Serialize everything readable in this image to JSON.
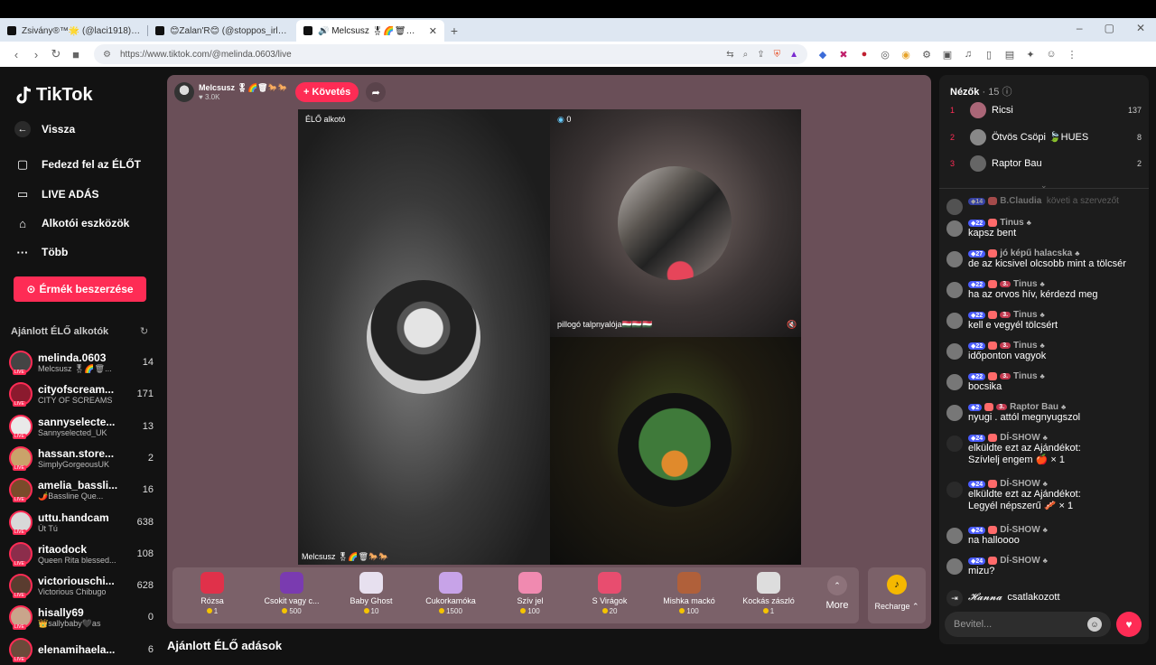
{
  "browser": {
    "tabs": [
      {
        "title": "Zsivány®™🌟 (@laci1918) ÉLŐ adás"
      },
      {
        "title": "😊Zalan'R😊 (@stoppos_irl) ÉLŐ ad"
      },
      {
        "title": "🔊 Melcsusz 🎖🌈🗑📦🎁🐎 (@"
      }
    ],
    "url": "https://www.tiktok.com/@melinda.0603/live",
    "window_controls": [
      "–",
      "▢",
      "✕"
    ]
  },
  "leftnav": {
    "logo": "TikTok",
    "back": "Vissza",
    "items": [
      {
        "label": "Fedezd fel az ÉLŐT",
        "icon": "explore-icon"
      },
      {
        "label": "LIVE ADÁS",
        "icon": "live-camera-icon"
      },
      {
        "label": "Alkotói eszközök",
        "icon": "creator-tools-icon"
      },
      {
        "label": "Több",
        "icon": "more-dots-icon"
      }
    ],
    "coins_button": "Érmék beszerzése",
    "recommended_title": "Ajánlott ÉLŐ alkotók",
    "creators": [
      {
        "name": "melinda.0603",
        "sub": "Melcsusz 🎖🌈🗑...",
        "count": "14",
        "color": "#444"
      },
      {
        "name": "cityofscream...",
        "sub": "CITY OF SCREAMS",
        "count": "171",
        "color": "#8b1a2e"
      },
      {
        "name": "sannyselecte...",
        "sub": "Sannyselected_UK",
        "count": "13",
        "color": "#e9e9e9"
      },
      {
        "name": "hassan.store...",
        "sub": "SimplyGorgeousUK",
        "count": "2",
        "color": "#caa36a"
      },
      {
        "name": "amelia_bassli...",
        "sub": "🌶️Bassline Que...",
        "count": "16",
        "color": "#7a4b2a"
      },
      {
        "name": "uttu.handcam",
        "sub": "Út Tú",
        "count": "638",
        "color": "#d8d8d8"
      },
      {
        "name": "ritaodock",
        "sub": "Queen Rita blessed...",
        "count": "108",
        "color": "#8c2d4b"
      },
      {
        "name": "victoriouschi...",
        "sub": "Victorious Chibugo",
        "count": "628",
        "color": "#5a3c2f"
      },
      {
        "name": "hisally69",
        "sub": "👑sallybaby🖤as",
        "count": "0",
        "color": "#c9a58b"
      },
      {
        "name": "elenamihaela...",
        "sub": "",
        "count": "6",
        "color": "#6b4a3a"
      }
    ]
  },
  "stage": {
    "host_name": "Melcsusz 🎖🌈🗑🐎🐎",
    "host_likes": "3.0K",
    "follow_label": "+ Követés",
    "main_label": "ÉLŐ alkotó",
    "main_bottom_label": "Melcsusz 🎖🌈🗑🐎🐎",
    "guest1_count": "0",
    "guest1_label": "pillogó talpnyalója🇭🇺🇭🇺🇭🇺",
    "gifts": [
      {
        "name": "Rózsa",
        "price": "1",
        "color": "#e0314a"
      },
      {
        "name": "Csokit vagy c...",
        "price": "500",
        "color": "#7a3bb0"
      },
      {
        "name": "Baby Ghost",
        "price": "10",
        "color": "#e7e0ef"
      },
      {
        "name": "Cukorkamóka",
        "price": "1500",
        "color": "#c7a3e8"
      },
      {
        "name": "Szív jel",
        "price": "100",
        "color": "#f08ab0"
      },
      {
        "name": "S Virágok",
        "price": "20",
        "color": "#e84d6f"
      },
      {
        "name": "Mishka mackó",
        "price": "100",
        "color": "#b0603a"
      },
      {
        "name": "Kockás zászló",
        "price": "1",
        "color": "#dddddd"
      }
    ],
    "more_label": "More",
    "recharge_label": "Recharge ⌃"
  },
  "below_title": "Ajánlott ÉLŐ adások",
  "chat": {
    "viewers_title": "Nézők",
    "viewers_count": "· 15",
    "top_viewers": [
      {
        "rank": "1",
        "name": "Ricsi",
        "score": "137",
        "color": "#a67"
      },
      {
        "rank": "2",
        "name": "Ötvös Csöpi 🍃HUES",
        "score": "8",
        "color": "#888"
      },
      {
        "rank": "3",
        "name": "Raptor Bau",
        "score": "2",
        "color": "#666"
      }
    ],
    "messages": [
      {
        "user": "B.Claudia",
        "level": "14",
        "text": "követi a szervezőt",
        "fan": "",
        "inline": true
      },
      {
        "user": "Tinus",
        "level": "22",
        "text": "kapsz bent",
        "fan": ""
      },
      {
        "user": "jó képű halacska",
        "level": "27",
        "text": "de az kicsivel olcsobb mint a tölcsér",
        "fan": ""
      },
      {
        "user": "Tinus",
        "level": "22",
        "text": "ha az orvos hív, kérdezd meg",
        "fan": "3."
      },
      {
        "user": "Tinus",
        "level": "22",
        "text": "kell e vegyél tölcsért",
        "fan": "3."
      },
      {
        "user": "Tinus",
        "level": "22",
        "text": "időponton vagyok",
        "fan": "3."
      },
      {
        "user": "Tinus",
        "level": "22",
        "text": "bocsika",
        "fan": "3."
      },
      {
        "user": "Raptor Bau",
        "level": "2",
        "text": "nyugi . attól megnyugszol",
        "fan": "3."
      },
      {
        "user": "DÍ-SHOW",
        "level": "24",
        "text": "elküldte ezt az Ajándékot:",
        "text2": "Szívlelj engem 🍎 × 1",
        "fan": ""
      },
      {
        "user": "DÍ-SHOW",
        "level": "24",
        "text": "elküldte ezt az Ajándékot:",
        "text2": "Legyél népszerű 🥓 × 1",
        "fan": ""
      },
      {
        "user": "DÍ-SHOW",
        "level": "24",
        "text": "na halloooo",
        "fan": ""
      },
      {
        "user": "DÍ-SHOW",
        "level": "24",
        "text": "mizu?",
        "fan": ""
      }
    ],
    "join_user": "𝓗𝓪𝓷𝓷𝓪",
    "join_text": "csatlakozott",
    "input_placeholder": "Bevitel..."
  }
}
